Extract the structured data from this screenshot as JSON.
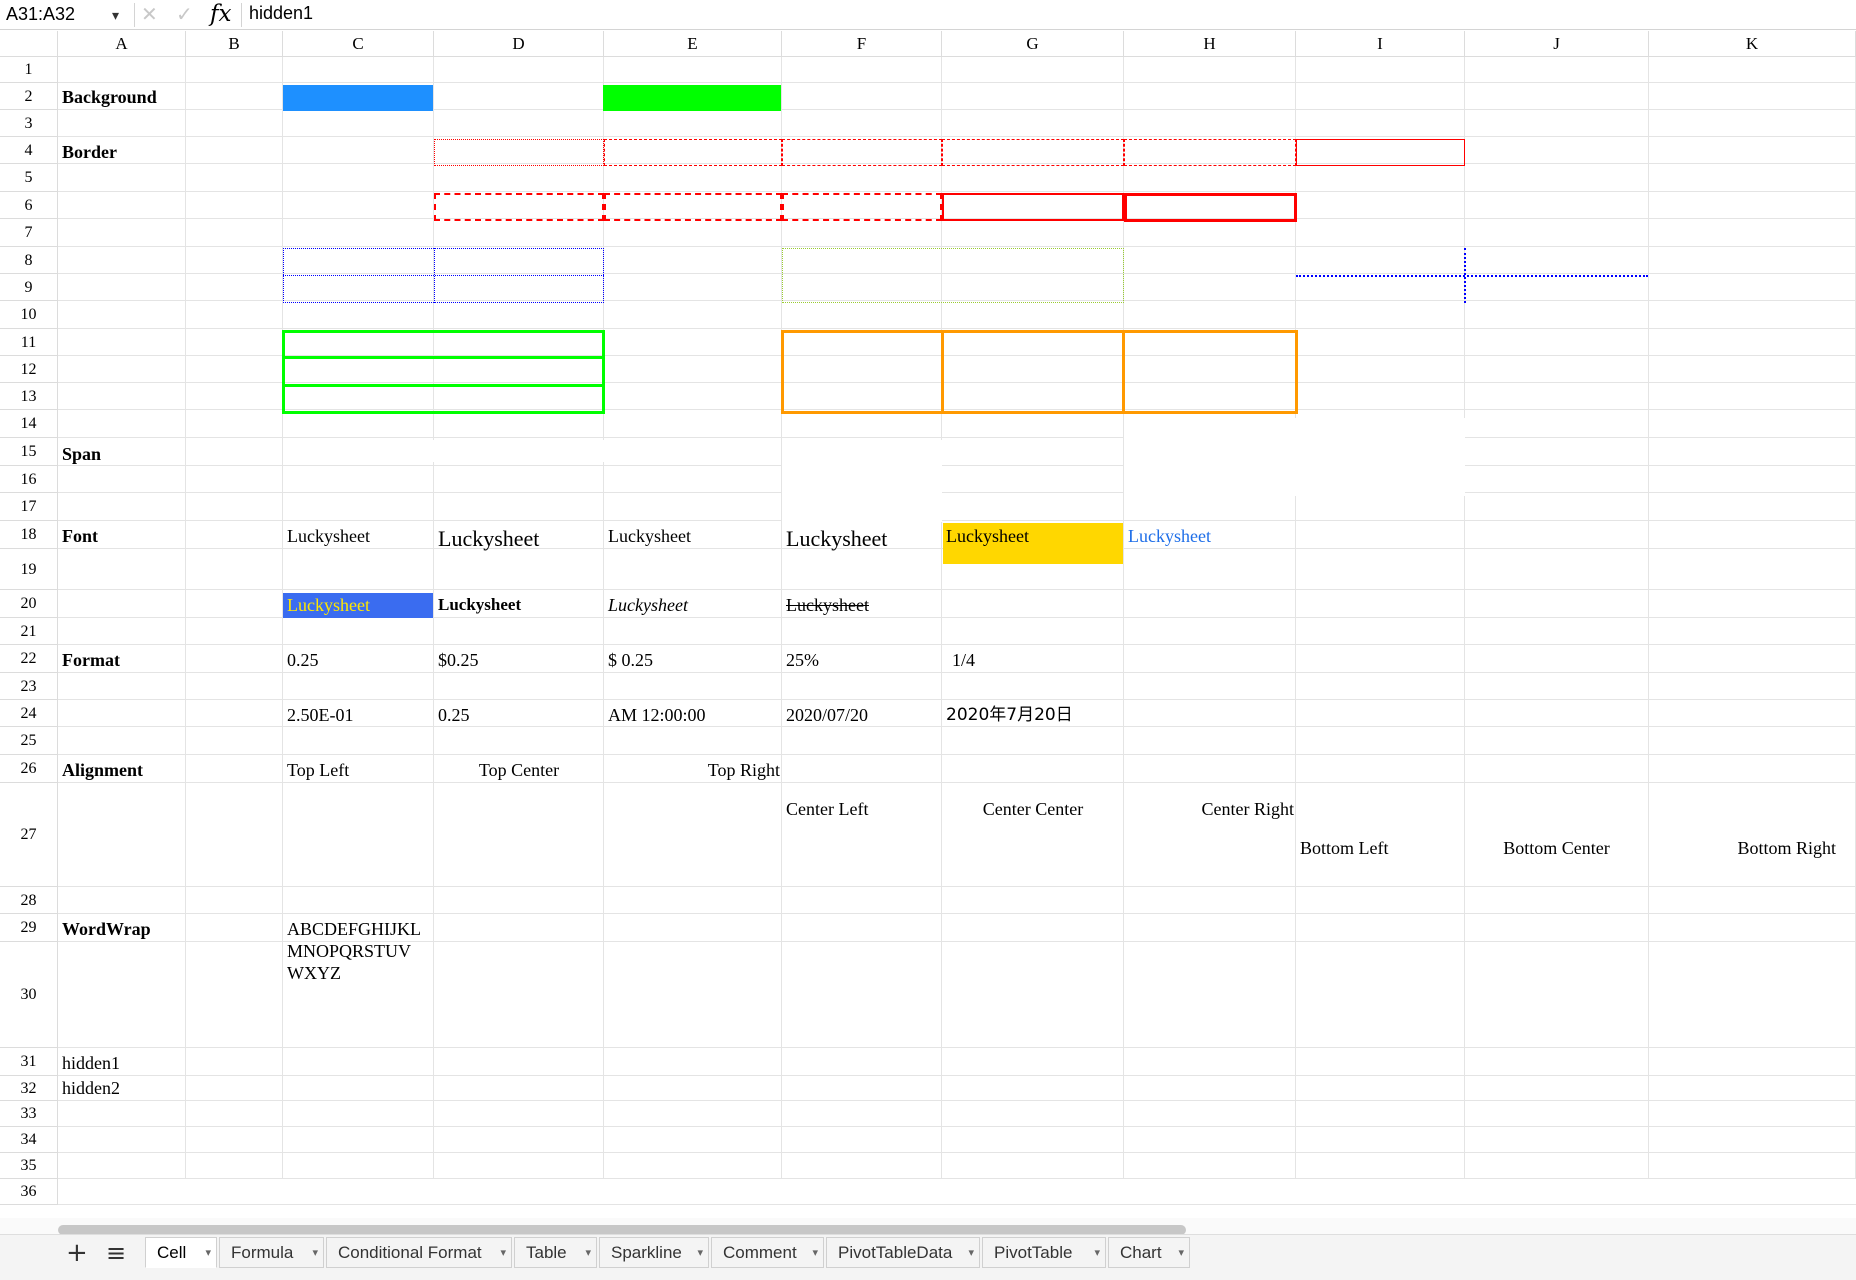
{
  "formula_bar": {
    "name_box": "A31:A32",
    "name_box_arrow": "▾",
    "cancel_icon": "✕",
    "confirm_icon": "✓",
    "fx_label": "fx",
    "formula": "hidden1"
  },
  "columns": [
    "A",
    "B",
    "C",
    "D",
    "E",
    "F",
    "G",
    "H",
    "I",
    "J",
    "K"
  ],
  "rows": [
    "1",
    "2",
    "3",
    "4",
    "5",
    "6",
    "7",
    "8",
    "9",
    "10",
    "11",
    "12",
    "13",
    "14",
    "15",
    "16",
    "17",
    "18",
    "19",
    "20",
    "21",
    "22",
    "23",
    "24",
    "25",
    "26",
    "27",
    "28",
    "29",
    "30",
    "31",
    "32",
    "33",
    "34",
    "35",
    "36"
  ],
  "colors": {
    "header_blue": "#1e90ff",
    "header_green": "#00ff00",
    "border_red": "#ff0000",
    "border_blue": "#0000ff",
    "border_green": "#00ff00",
    "border_orange": "#ff9900",
    "border_olive": "#9acd32",
    "font_yellow_bg": "#ffd700",
    "font_blue": "#1e6ee8",
    "highlight_bg": "#3a6cf0",
    "highlight_fg": "#ffe600"
  },
  "cells": {
    "a2": "Background",
    "a4": "Border",
    "a15": "Span",
    "a18": "Font",
    "c18": "Luckysheet",
    "d18": "Luckysheet",
    "e18": "Luckysheet",
    "f18": "Luckysheet",
    "g18": "Luckysheet",
    "h18": "Luckysheet",
    "c20": "Luckysheet",
    "d20": "Luckysheet",
    "e20": "Luckysheet",
    "f20": "Luckysheet",
    "a22": "Format",
    "c22": "0.25",
    "d22": "$0.25",
    "e22": "$ 0.25",
    "f22": "25%",
    "g22": "1/4",
    "c24": "2.50E-01",
    "d24": "0.25",
    "e24": "AM 12:00:00",
    "f24": "2020/07/20",
    "g24": "2020年7月20日",
    "a26": "Alignment",
    "c26": "Top Left",
    "d26": "Top Center",
    "e26": "Top Right",
    "f26": "Center Left",
    "g26": "Center Center",
    "h26": "Center Right",
    "i26": "Bottom Left",
    "j26": "Bottom Center",
    "k26": "Bottom Right",
    "a29": "WordWrap",
    "c29_line1": "ABCDEFGHIJKL",
    "c29_line2": "MNOPQRSTUV",
    "c29_line3": "WXYZ",
    "a31": "hidden1",
    "a32": "hidden2"
  },
  "bottom_bar": {
    "add_sheet_icon": "+",
    "sheet_list_icon": "≡",
    "tab_arrow": "▾",
    "tabs": [
      "Cell",
      "Formula",
      "Conditional Format",
      "Table",
      "Sparkline",
      "Comment",
      "PivotTableData",
      "PivotTable",
      "Chart"
    ],
    "active_tab": "Cell"
  }
}
